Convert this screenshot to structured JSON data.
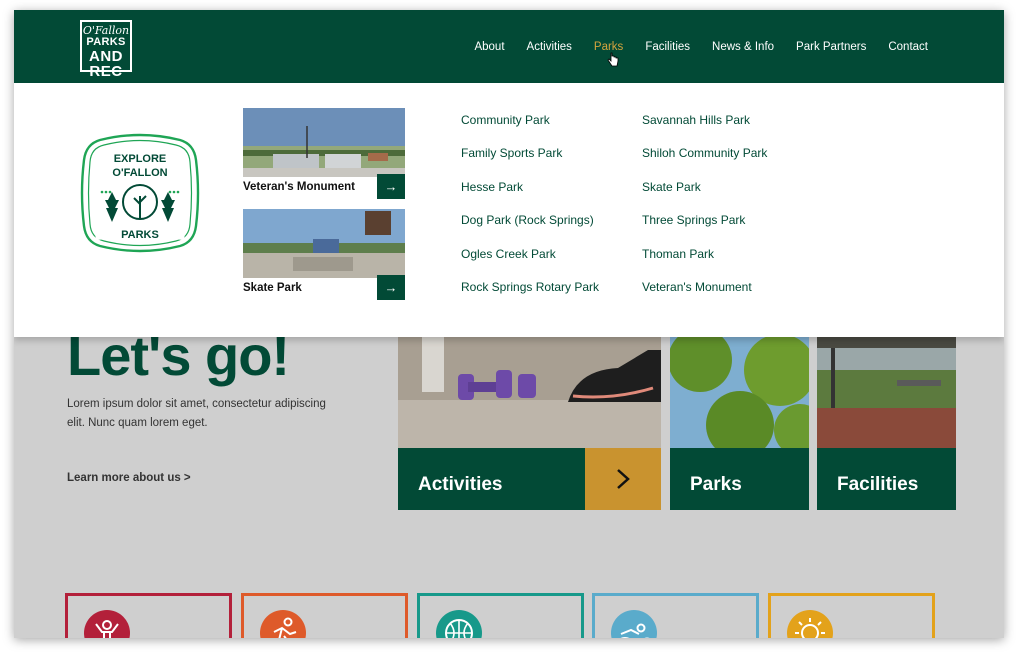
{
  "brand": {
    "logo_line1": "O'Fallon",
    "logo_line2": "PARKS",
    "logo_line3": "AND REC"
  },
  "nav": {
    "items": [
      "About",
      "Activities",
      "Parks",
      "Facilities",
      "News & Info",
      "Park Partners",
      "Contact"
    ],
    "active": "Parks"
  },
  "dropdown": {
    "badge": {
      "line1": "EXPLORE",
      "line2": "O'FALLON",
      "line3": "PARKS"
    },
    "featured": [
      {
        "caption": "Veteran's Monument",
        "arrow": "→"
      },
      {
        "caption": "Skate Park",
        "arrow": "→"
      }
    ],
    "parks_col1": [
      "Community Park",
      "Family Sports Park",
      "Hesse Park",
      "Dog Park (Rock Springs)",
      "Ogles Creek Park",
      "Rock Springs Rotary Park"
    ],
    "parks_col2": [
      "Savannah Hills Park",
      "Shiloh Community Park",
      "Skate Park",
      "Three Springs Park",
      "Thoman Park",
      "Veteran's Monument"
    ]
  },
  "hero": {
    "title": "Let's go!",
    "text": "Lorem ipsum dolor sit amet, consectetur adipiscing elit. Nunc quam lorem eget.",
    "learn_more": "Learn more about us >"
  },
  "cards": [
    {
      "label": "Activities"
    },
    {
      "label": "Parks"
    },
    {
      "label": "Facilities"
    }
  ],
  "colors": {
    "brand_green": "#024a36",
    "accent_gold": "#c9932f",
    "nav_active": "#d5a43e",
    "badge_green": "#1fa555",
    "tile_colors": [
      "#b3203a",
      "#de5a2a",
      "#17998a",
      "#5aabcb",
      "#e3a21b"
    ]
  }
}
